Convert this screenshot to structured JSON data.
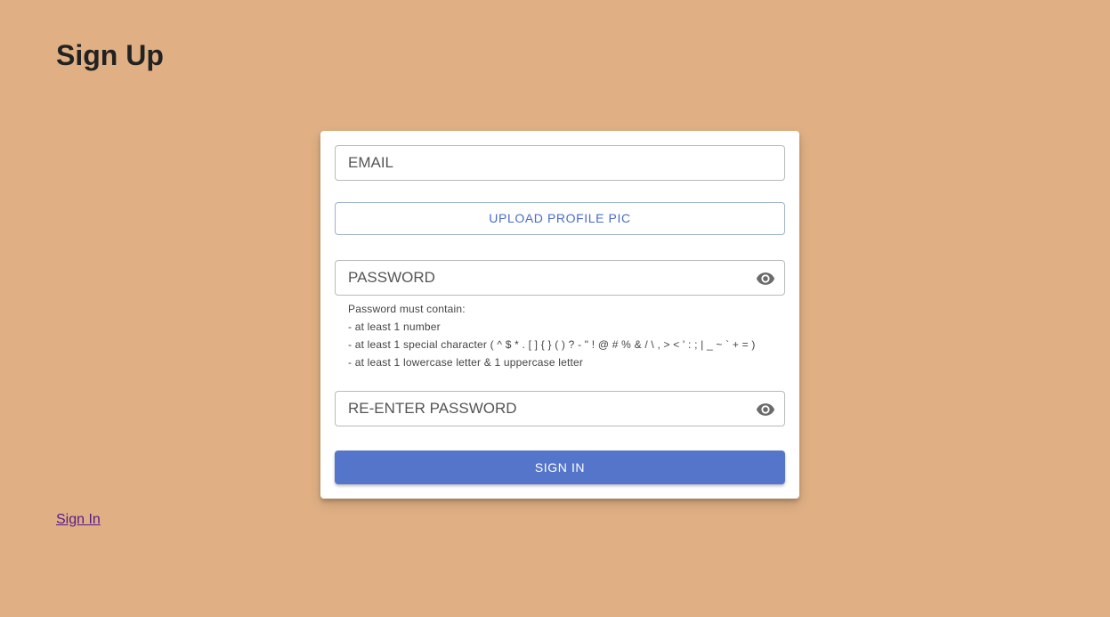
{
  "page": {
    "title": "Sign Up",
    "background_color": "#e0b084"
  },
  "form": {
    "email_placeholder": "EMAIL",
    "upload_label": "UPLOAD PROFILE PIC",
    "password_placeholder": "PASSWORD",
    "password_rules": {
      "heading": "Password must contain:",
      "items": [
        "- at least 1 number",
        "- at least 1 special character ( ^ $ * . [ ] { } ( ) ? - \" ! @ # % & / \\ , > < ' : ; | _ ~ ` + = )",
        "- at least 1 lowercase letter & 1 uppercase letter"
      ]
    },
    "reenter_password_placeholder": "RE-ENTER PASSWORD",
    "submit_label": "SIGN IN",
    "accent_color": "#5475c9",
    "icons": {
      "password_toggle": "eye-icon",
      "reenter_toggle": "eye-icon"
    }
  },
  "footer": {
    "signin_link": "Sign In"
  }
}
